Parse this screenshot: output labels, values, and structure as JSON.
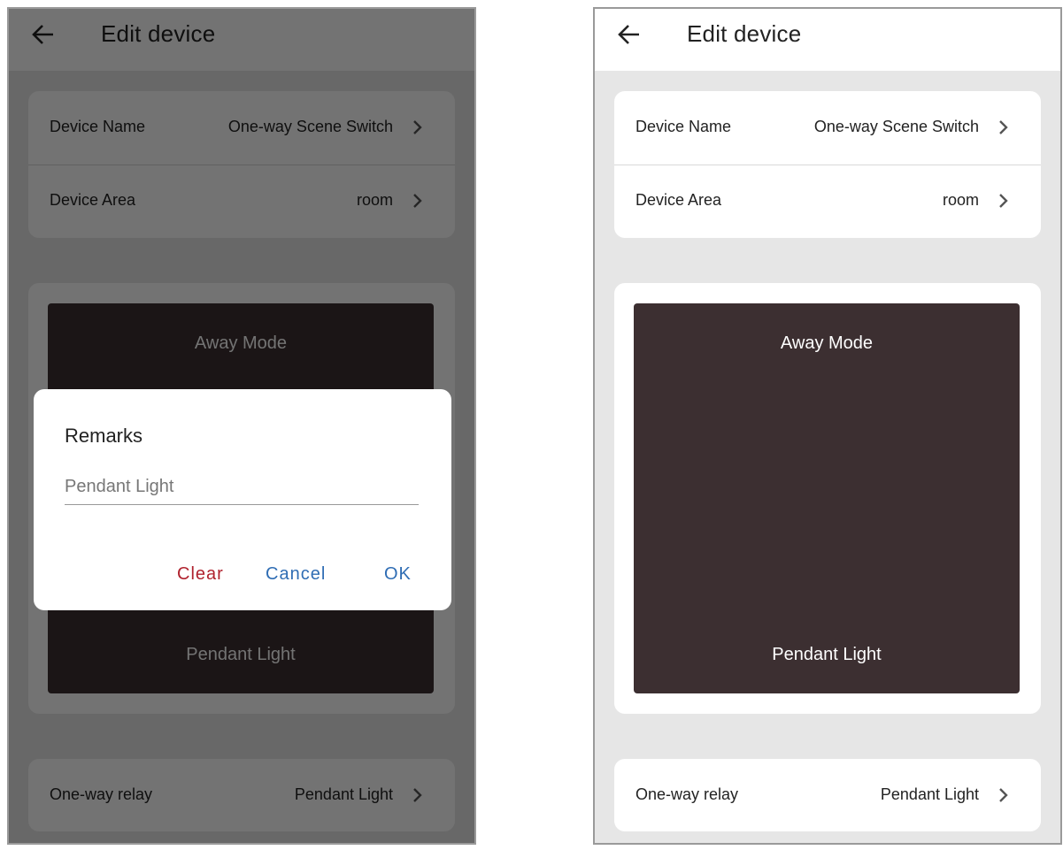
{
  "header": {
    "title": "Edit device"
  },
  "device": {
    "name_label": "Device Name",
    "name_value": "One-way Scene Switch",
    "area_label": "Device Area",
    "area_value": "room"
  },
  "scene": {
    "top_label": "Away Mode",
    "bottom_label": "Pendant Light"
  },
  "relay": {
    "label": "One-way relay",
    "value": "Pendant Light"
  },
  "dialog": {
    "title": "Remarks",
    "input_value": "Pendant Light",
    "clear_label": "Clear",
    "cancel_label": "Cancel",
    "ok_label": "OK"
  },
  "colors": {
    "panel": "#3c2f31",
    "clear": "#b0222e",
    "action": "#2f6db4"
  }
}
